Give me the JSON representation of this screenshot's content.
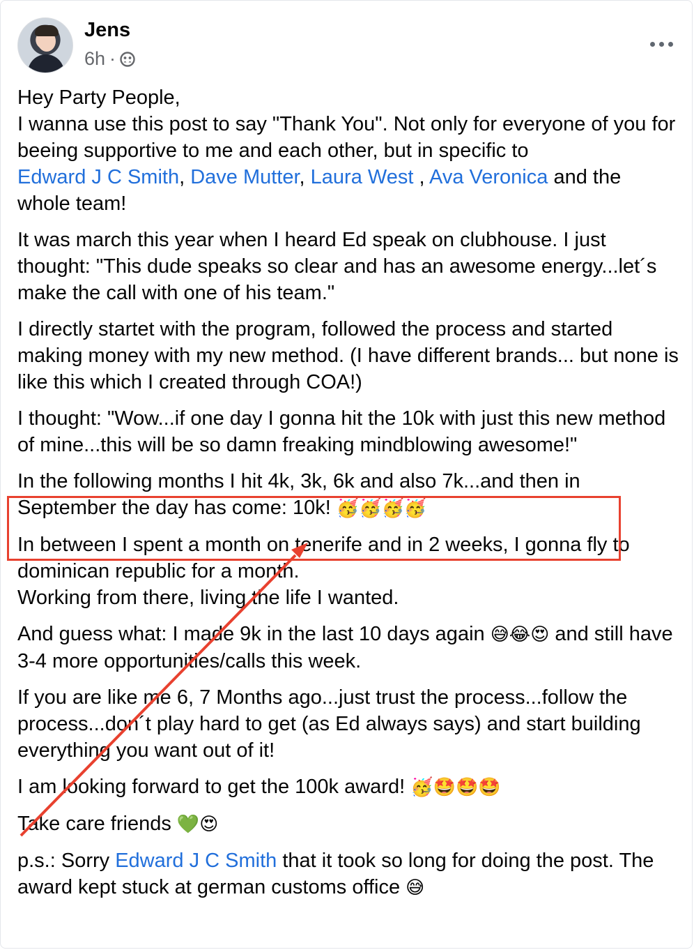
{
  "post": {
    "author": "Jens",
    "time": "6h",
    "separator": "·",
    "privacy_icon": "friends-icon",
    "more_icon": "more-options-icon"
  },
  "paragraphs": {
    "p1": {
      "l1": "Hey Party People,",
      "l2": "I wanna use this post to say \"Thank You\". Not only for everyone of you for beeing supportive to me and each other, but in specific to",
      "tag1": "Edward J C Smith",
      "sep1": ", ",
      "tag2": "Dave Mutter",
      "sep2": ", ",
      "tag3": "Laura West",
      "sep3": " , ",
      "tag4": "Ava Veronica",
      "end": " and the whole team!"
    },
    "p2": "It was march this year when I heard Ed speak on clubhouse. I just thought: \"This dude speaks so clear and has an awesome energy...let´s make the call with one of his team.\"",
    "p3": "I directly startet with the program, followed the process and started making money with my new method. (I have different brands... but none is like this which I created through COA!)",
    "p4": "I thought: \"Wow...if one day I gonna hit the 10k with just this new method of mine...this will be so damn freaking mindblowing awesome!\"",
    "p5": {
      "text": "In the following months I hit 4k, 3k, 6k and also 7k...and then in September the day has come: 10k! ",
      "emoji": "🥳🥳🥳🥳"
    },
    "p6": {
      "l1": "In between I spent a month on tenerife and in 2 weeks, I gonna fly to dominican republic for a month.",
      "l2": "Working from there, living the life I wanted."
    },
    "p7": {
      "a": "And guess what: I made 9k in the last 10 days again ",
      "emoji": "😅😂😍",
      "b": " and still have 3-4 more opportunities/calls this week."
    },
    "p8": "If you are like me 6, 7 Months ago...just trust the process...follow the process...don´t play hard to get (as Ed always says) and start building everything you want out of it!",
    "p9": {
      "text": "I am looking forward to get the 100k award! ",
      "emoji": "🥳🤩🤩🤩"
    },
    "p10": {
      "text": "Take care friends ",
      "emoji": "💚😍"
    },
    "p11": {
      "a": "p.s.: Sorry ",
      "tag": "Edward J C Smith",
      "b": " that it took so long for doing the post. The award kept stuck at german customs office ",
      "emoji": "😅"
    }
  },
  "colors": {
    "tag": "#216fdb",
    "annotation": "#e8412f",
    "meta": "#65676b"
  }
}
